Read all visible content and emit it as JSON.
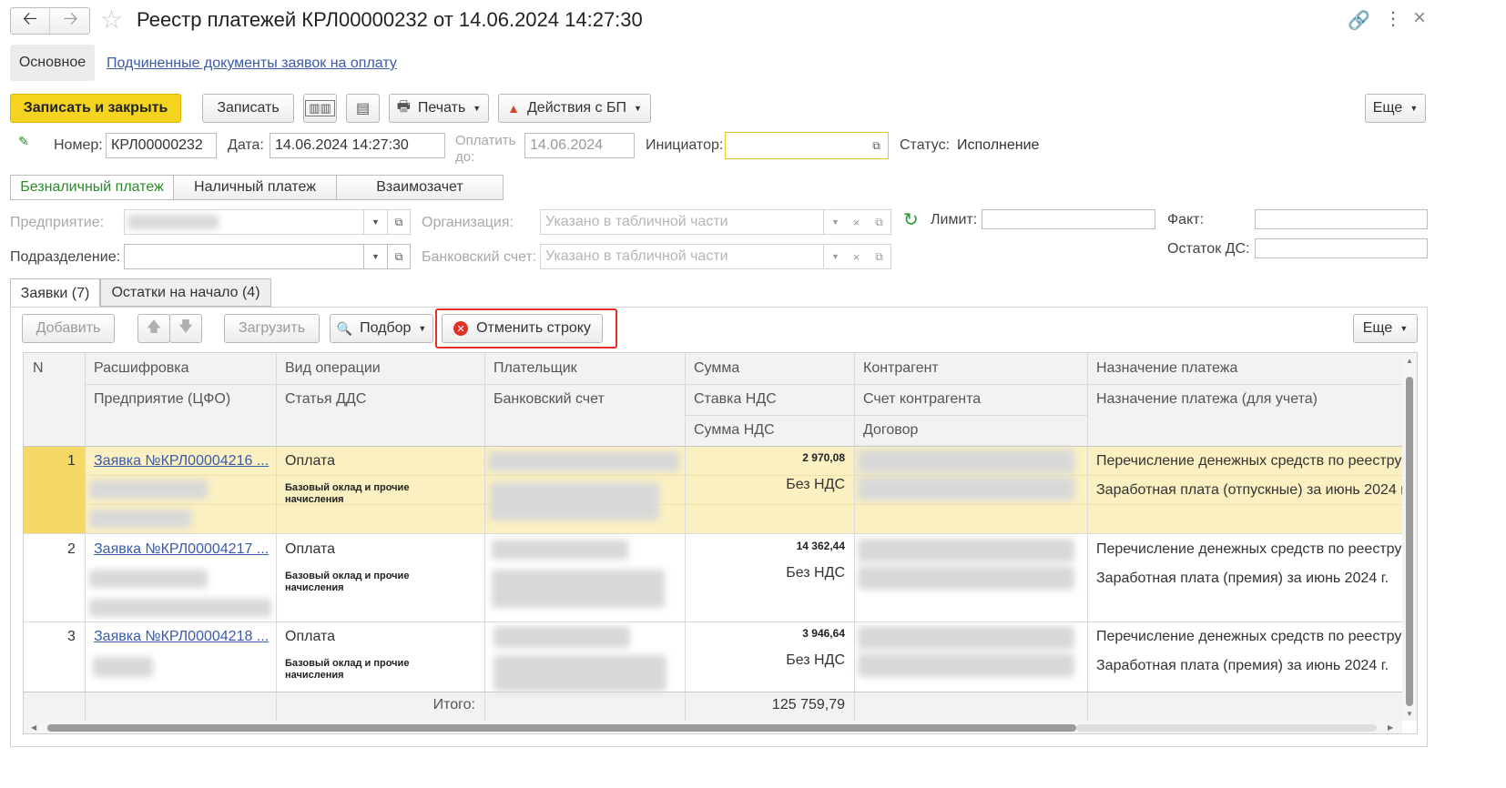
{
  "window": {
    "title": "Реестр платежей КРЛ00000232 от 14.06.2024 14:27:30"
  },
  "nav": {
    "main_tab": "Основное",
    "sub_docs_link": "Подчиненные документы заявок на оплату"
  },
  "toolbar": {
    "save_close": "Записать и закрыть",
    "save": "Записать",
    "print": "Печать",
    "bp_actions": "Действия с БП",
    "more": "Еще"
  },
  "header": {
    "number_label": "Номер:",
    "number_value": "КРЛ00000232",
    "date_label": "Дата:",
    "date_value": "14.06.2024 14:27:30",
    "pay_until_label_1": "Оплатить",
    "pay_until_label_2": "до:",
    "pay_until_value": "14.06.2024",
    "initiator_label": "Инициатор:",
    "initiator_value": "",
    "status_label": "Статус:",
    "status_value": "Исполнение"
  },
  "payment_tabs": [
    "Безналичный платеж",
    "Наличный платеж",
    "Взаимозачет"
  ],
  "form": {
    "enterprise_label": "Предприятие:",
    "org_label": "Организация:",
    "org_placeholder": "Указано в табличной части",
    "division_label": "Подразделение:",
    "bank_label": "Банковский счет:",
    "bank_placeholder": "Указано в табличной части",
    "limit_label": "Лимит:",
    "fact_label": "Факт:",
    "balance_label": "Остаток ДС:"
  },
  "table_tabs": [
    "Заявки (7)",
    "Остатки на начало (4)"
  ],
  "table_toolbar": {
    "add": "Добавить",
    "load": "Загрузить",
    "select": "Подбор",
    "cancel_row": "Отменить строку",
    "more": "Еще"
  },
  "columns": {
    "n": "N",
    "decode": "Расшифровка",
    "enterprise_cfo": "Предприятие (ЦФО)",
    "op_type": "Вид операции",
    "dds": "Статья ДДС",
    "payer": "Плательщик",
    "bank": "Банковский счет",
    "sum": "Сумма",
    "vat_rate": "Ставка НДС",
    "vat_sum": "Сумма НДС",
    "counterparty": "Контрагент",
    "cp_account": "Счет контрагента",
    "contract": "Договор",
    "purpose": "Назначение платежа",
    "purpose_acc": "Назначение платежа (для учета)"
  },
  "rows": [
    {
      "n": "1",
      "request": "Заявка №КРЛ00004216 ...",
      "op": "Оплата",
      "dds": "Базовый оклад и прочие начисления",
      "sum": "2 970,08",
      "vat": "Без НДС",
      "purpose": "Перечисление денежных средств по реестру",
      "purpose_acc": "Заработная плата (отпускные) за июнь 2024 г."
    },
    {
      "n": "2",
      "request": "Заявка №КРЛ00004217 ...",
      "op": "Оплата",
      "dds": "Базовый оклад и прочие начисления",
      "sum": "14 362,44",
      "vat": "Без НДС",
      "purpose": "Перечисление денежных средств по реестру",
      "purpose_acc": "Заработная плата (премия) за июнь 2024 г."
    },
    {
      "n": "3",
      "request": "Заявка №КРЛ00004218 ...",
      "op": "Оплата",
      "dds": "Базовый оклад и прочие начисления",
      "sum": "3 946,64",
      "vat": "Без НДС",
      "purpose": "Перечисление денежных средств по реестру",
      "purpose_acc": "Заработная плата (премия) за июнь 2024 г."
    }
  ],
  "footer": {
    "total_label": "Итого:",
    "total_value": "125 759,79"
  },
  "colors": {
    "accent_yellow": "#f5d41f",
    "row_highlight": "#fbf0c2",
    "highlight_red": "#e0312b",
    "link_blue": "#3b5aa8",
    "active_tab_green": "#2a8a2a"
  }
}
